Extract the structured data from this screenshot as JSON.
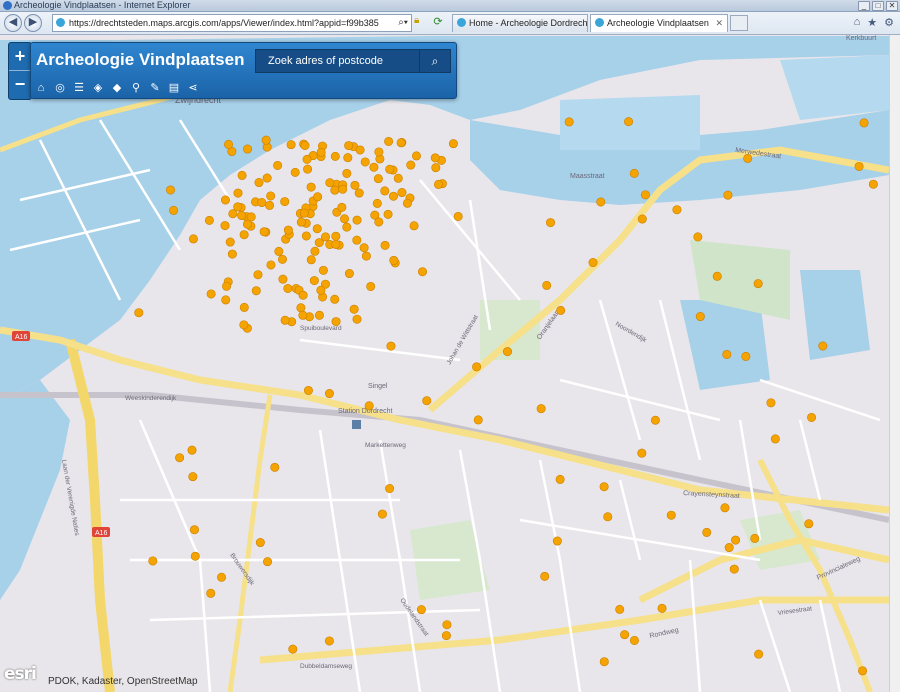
{
  "window": {
    "title": "Archeologie Vindplaatsen - Internet Explorer"
  },
  "browser": {
    "url": "https://drechtsteden.maps.arcgis.com/apps/Viewer/index.html?appid=f99b3857e2cf4eb992",
    "tabs": [
      {
        "label": "Home - Archeologie Dordrecht"
      },
      {
        "label": "Archeologie Vindplaatsen"
      }
    ]
  },
  "app": {
    "title": "Archeologie Vindplaatsen",
    "search_placeholder": "Zoek adres of postcode",
    "zoom_in": "+",
    "zoom_out": "−",
    "attribution": "PDOK, Kadaster, OpenStreetMap",
    "logo": "esri",
    "tools": [
      "home-icon",
      "locate-icon",
      "list-icon",
      "layers-icon",
      "basemap-icon",
      "measure-icon",
      "edit-icon",
      "comment-icon",
      "share-icon"
    ]
  },
  "colors": {
    "water": "#a7d0e9",
    "land": "#e8e6ea",
    "road_major": "#f6e08a",
    "marker": "#f5a300",
    "panel": "#2473bd"
  },
  "map_labels": {
    "zwijndrecht": "Zwijndrecht",
    "station": "Station Dordrecht",
    "a16_1": "A16",
    "a16_2": "A16",
    "merwedestraat": "Merwedestraat",
    "maasstraat": "Maasstraat",
    "oranjelaan": "Oranjelaan",
    "crayensteynstraat": "Crayensteynstraat",
    "provincialeweg": "Provincialeweg",
    "rondweg": "Rondweg",
    "spuiboulevard": "Spuiboulevard",
    "singel": "Singel",
    "dordtse_kil": "Laan der Verenigde Naties",
    "kerkhuurt": "Kerkbuurt",
    "weeskinderendijk": "Weeskinderendijk",
    "markettenweg": "Markettenweg",
    "noordendijk": "Noordendijk",
    "vriesestraat": "Vriesestraat",
    "johanderwittstraat": "Johan de Wittstraat",
    "brouwersdijk": "Brouwersdijk",
    "dubbeldamseweg": "Dubbeldamseweg",
    "oudelandstraat": "Oudelandstraat"
  }
}
